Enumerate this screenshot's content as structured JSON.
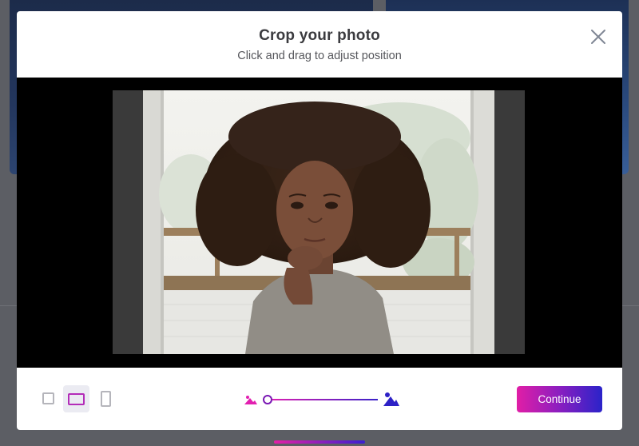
{
  "modal": {
    "title": "Crop your photo",
    "subtitle": "Click and drag to adjust position",
    "close_icon": "close-icon"
  },
  "crop": {
    "image_alt": "photo-being-cropped"
  },
  "toolbar": {
    "aspect_options": [
      {
        "name": "square",
        "icon": "square-crop-icon",
        "selected": false
      },
      {
        "name": "landscape",
        "icon": "landscape-crop-icon",
        "selected": true
      },
      {
        "name": "portrait",
        "icon": "portrait-crop-icon",
        "selected": false
      }
    ],
    "zoom": {
      "min_icon": "small-image-icon",
      "max_icon": "large-image-icon",
      "value": 0.0
    },
    "continue_label": "Continue"
  },
  "colors": {
    "accent_start": "#e11ea6",
    "accent_end": "#2a23c9",
    "selected_ratio": "#b32cb8"
  }
}
